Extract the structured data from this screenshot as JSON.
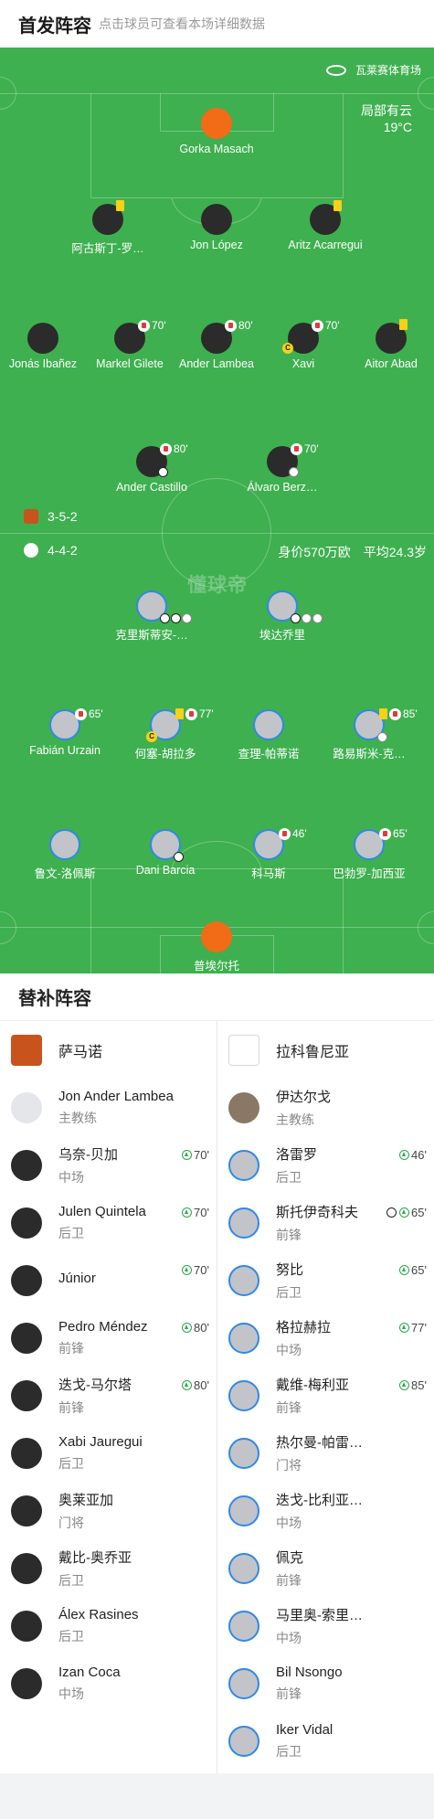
{
  "header": {
    "title": "首发阵容",
    "subtitle": "点击球员可查看本场详细数据"
  },
  "pitch": {
    "venue": "瓦莱赛体育场",
    "weather": "局部有云",
    "temperature": "19°C",
    "watermark": "懂球帝",
    "home_formation": "3-5-2",
    "away_formation": "4-4-2",
    "away_value": "身价570万欧",
    "away_avg_age": "平均24.3岁"
  },
  "home_players": [
    {
      "name": "Gorka Masach",
      "role": "gk"
    },
    {
      "name": "阿古斯丁-罗…",
      "yellow": true
    },
    {
      "name": "Jon López"
    },
    {
      "name": "Aritz Acarregui",
      "yellow": true
    },
    {
      "name": "Jonás Ibañez"
    },
    {
      "name": "Markel Gilete",
      "sub_time": "70'"
    },
    {
      "name": "Ander Lambea",
      "sub_time": "80'"
    },
    {
      "name": "Xavi",
      "sub_time": "70'",
      "captain": "C"
    },
    {
      "name": "Aitor Abad",
      "yellow": true
    },
    {
      "name": "Ander Castillo",
      "sub_time": "80'",
      "goals": 1
    },
    {
      "name": "Álvaro Berz…",
      "sub_time": "70'",
      "own_goals": 1
    }
  ],
  "away_players": [
    {
      "name": "克里斯蒂安-…",
      "goals": 2,
      "own_goals": 1
    },
    {
      "name": "埃达乔里",
      "goals": 1,
      "own_goals": 2
    },
    {
      "name": "Fabián Urzain",
      "sub_time": "65'"
    },
    {
      "name": "何塞-胡拉多",
      "sub_time": "77'",
      "yellow": true,
      "captain": "C"
    },
    {
      "name": "查理-帕蒂诺"
    },
    {
      "name": "路易斯米-克…",
      "sub_time": "85'",
      "yellow": true,
      "own_goals": 1
    },
    {
      "name": "鲁文-洛佩斯"
    },
    {
      "name": "Dani Barcia",
      "goals": 1
    },
    {
      "name": "科马斯",
      "sub_time": "46'"
    },
    {
      "name": "巴勃罗-加西亚",
      "sub_time": "65'"
    },
    {
      "name": "普埃尔托",
      "role": "gk"
    }
  ],
  "subs": {
    "title": "替补阵容",
    "home_team": "萨马诺",
    "away_team": "拉科鲁尼亚",
    "home_coach": {
      "name": "Jon Ander Lambea",
      "role": "主教练"
    },
    "away_coach": {
      "name": "伊达尔戈",
      "role": "主教练"
    },
    "home": [
      {
        "name": "乌奈-贝加",
        "pos": "中场",
        "in": "70'"
      },
      {
        "name": "Julen Quintela",
        "pos": "后卫",
        "in": "70'"
      },
      {
        "name": "Júnior",
        "pos": "",
        "in": "70'"
      },
      {
        "name": "Pedro Méndez",
        "pos": "前锋",
        "in": "80'"
      },
      {
        "name": "迭戈-马尔塔",
        "pos": "前锋",
        "in": "80'"
      },
      {
        "name": "Xabi Jauregui",
        "pos": "后卫"
      },
      {
        "name": "奥莱亚加",
        "pos": "门将"
      },
      {
        "name": "戴比-奥乔亚",
        "pos": "后卫"
      },
      {
        "name": "Álex Rasines",
        "pos": "后卫"
      },
      {
        "name": "Izan Coca",
        "pos": "中场"
      }
    ],
    "away": [
      {
        "name": "洛雷罗",
        "pos": "后卫",
        "in": "46'"
      },
      {
        "name": "斯托伊奇科夫",
        "pos": "前锋",
        "in": "65'",
        "goal": true
      },
      {
        "name": "努比",
        "pos": "后卫",
        "in": "65'"
      },
      {
        "name": "格拉赫拉",
        "pos": "中场",
        "in": "77'"
      },
      {
        "name": "戴维-梅利亚",
        "pos": "前锋",
        "in": "85'"
      },
      {
        "name": "热尔曼-帕雷…",
        "pos": "门将"
      },
      {
        "name": "迭戈-比利亚…",
        "pos": "中场"
      },
      {
        "name": "佩克",
        "pos": "前锋"
      },
      {
        "name": "马里奥-索里…",
        "pos": "中场"
      },
      {
        "name": "Bil Nsongo",
        "pos": "前锋"
      },
      {
        "name": "Iker Vidal",
        "pos": "后卫"
      }
    ]
  },
  "colors": {
    "pitch": "#3eb04f",
    "home_kit": "#2b2b2b",
    "away_kit": "#c2c4c9",
    "keeper": "#f26b16",
    "away_border": "#2f89e6"
  }
}
